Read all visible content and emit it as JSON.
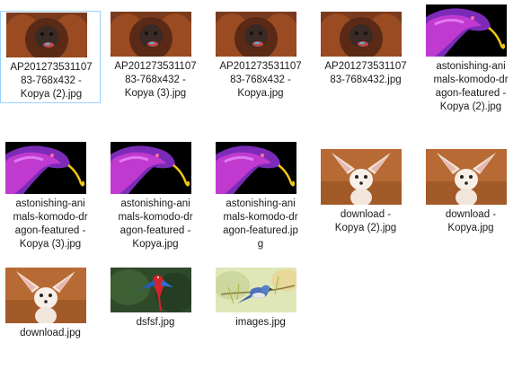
{
  "files": [
    {
      "name": "AP20127353110783-768x432 - Kopya (2).jpg",
      "lines": [
        "AP201273531107",
        "83-768x432 -",
        "Kopya (2).jpg"
      ],
      "kind": "orangutan",
      "selected": true
    },
    {
      "name": "AP20127353110783-768x432 - Kopya (3).jpg",
      "lines": [
        "AP201273531107",
        "83-768x432 -",
        "Kopya (3).jpg"
      ],
      "kind": "orangutan"
    },
    {
      "name": "AP20127353110783-768x432 - Kopya.jpg",
      "lines": [
        "AP201273531107",
        "83-768x432 -",
        "Kopya.jpg"
      ],
      "kind": "orangutan"
    },
    {
      "name": "AP20127353110783-768x432.jpg",
      "lines": [
        "AP201273531107",
        "83-768x432.jpg"
      ],
      "kind": "orangutan"
    },
    {
      "name": "astonishing-animals-komodo-dragon-featured - Kopya (2).jpg",
      "lines": [
        "astonishing-ani",
        "mals-komodo-dr",
        "agon-featured -",
        "Kopya (2).jpg"
      ],
      "kind": "dragon"
    },
    {
      "name": "astonishing-animals-komodo-dragon-featured - Kopya (3).jpg",
      "lines": [
        "astonishing-ani",
        "mals-komodo-dr",
        "agon-featured -",
        "Kopya (3).jpg"
      ],
      "kind": "dragon"
    },
    {
      "name": "astonishing-animals-komodo-dragon-featured - Kopya.jpg",
      "lines": [
        "astonishing-ani",
        "mals-komodo-dr",
        "agon-featured -",
        "Kopya.jpg"
      ],
      "kind": "dragon"
    },
    {
      "name": "astonishing-animals-komodo-dragon-featured.jpg",
      "lines": [
        "astonishing-ani",
        "mals-komodo-dr",
        "agon-featured.jp",
        "g"
      ],
      "kind": "dragon"
    },
    {
      "name": "download - Kopya (2).jpg",
      "lines": [
        "download -",
        "Kopya (2).jpg"
      ],
      "kind": "fox"
    },
    {
      "name": "download - Kopya.jpg",
      "lines": [
        "download -",
        "Kopya.jpg"
      ],
      "kind": "fox"
    },
    {
      "name": "download.jpg",
      "lines": [
        "download.jpg"
      ],
      "kind": "fox"
    },
    {
      "name": "dsfsf.jpg",
      "lines": [
        "dsfsf.jpg"
      ],
      "kind": "parrot"
    },
    {
      "name": "images.jpg",
      "lines": [
        "images.jpg"
      ],
      "kind": "bird"
    }
  ],
  "colors": {
    "selection_border": "#99d1ff",
    "label_text": "#1a1a1a"
  }
}
